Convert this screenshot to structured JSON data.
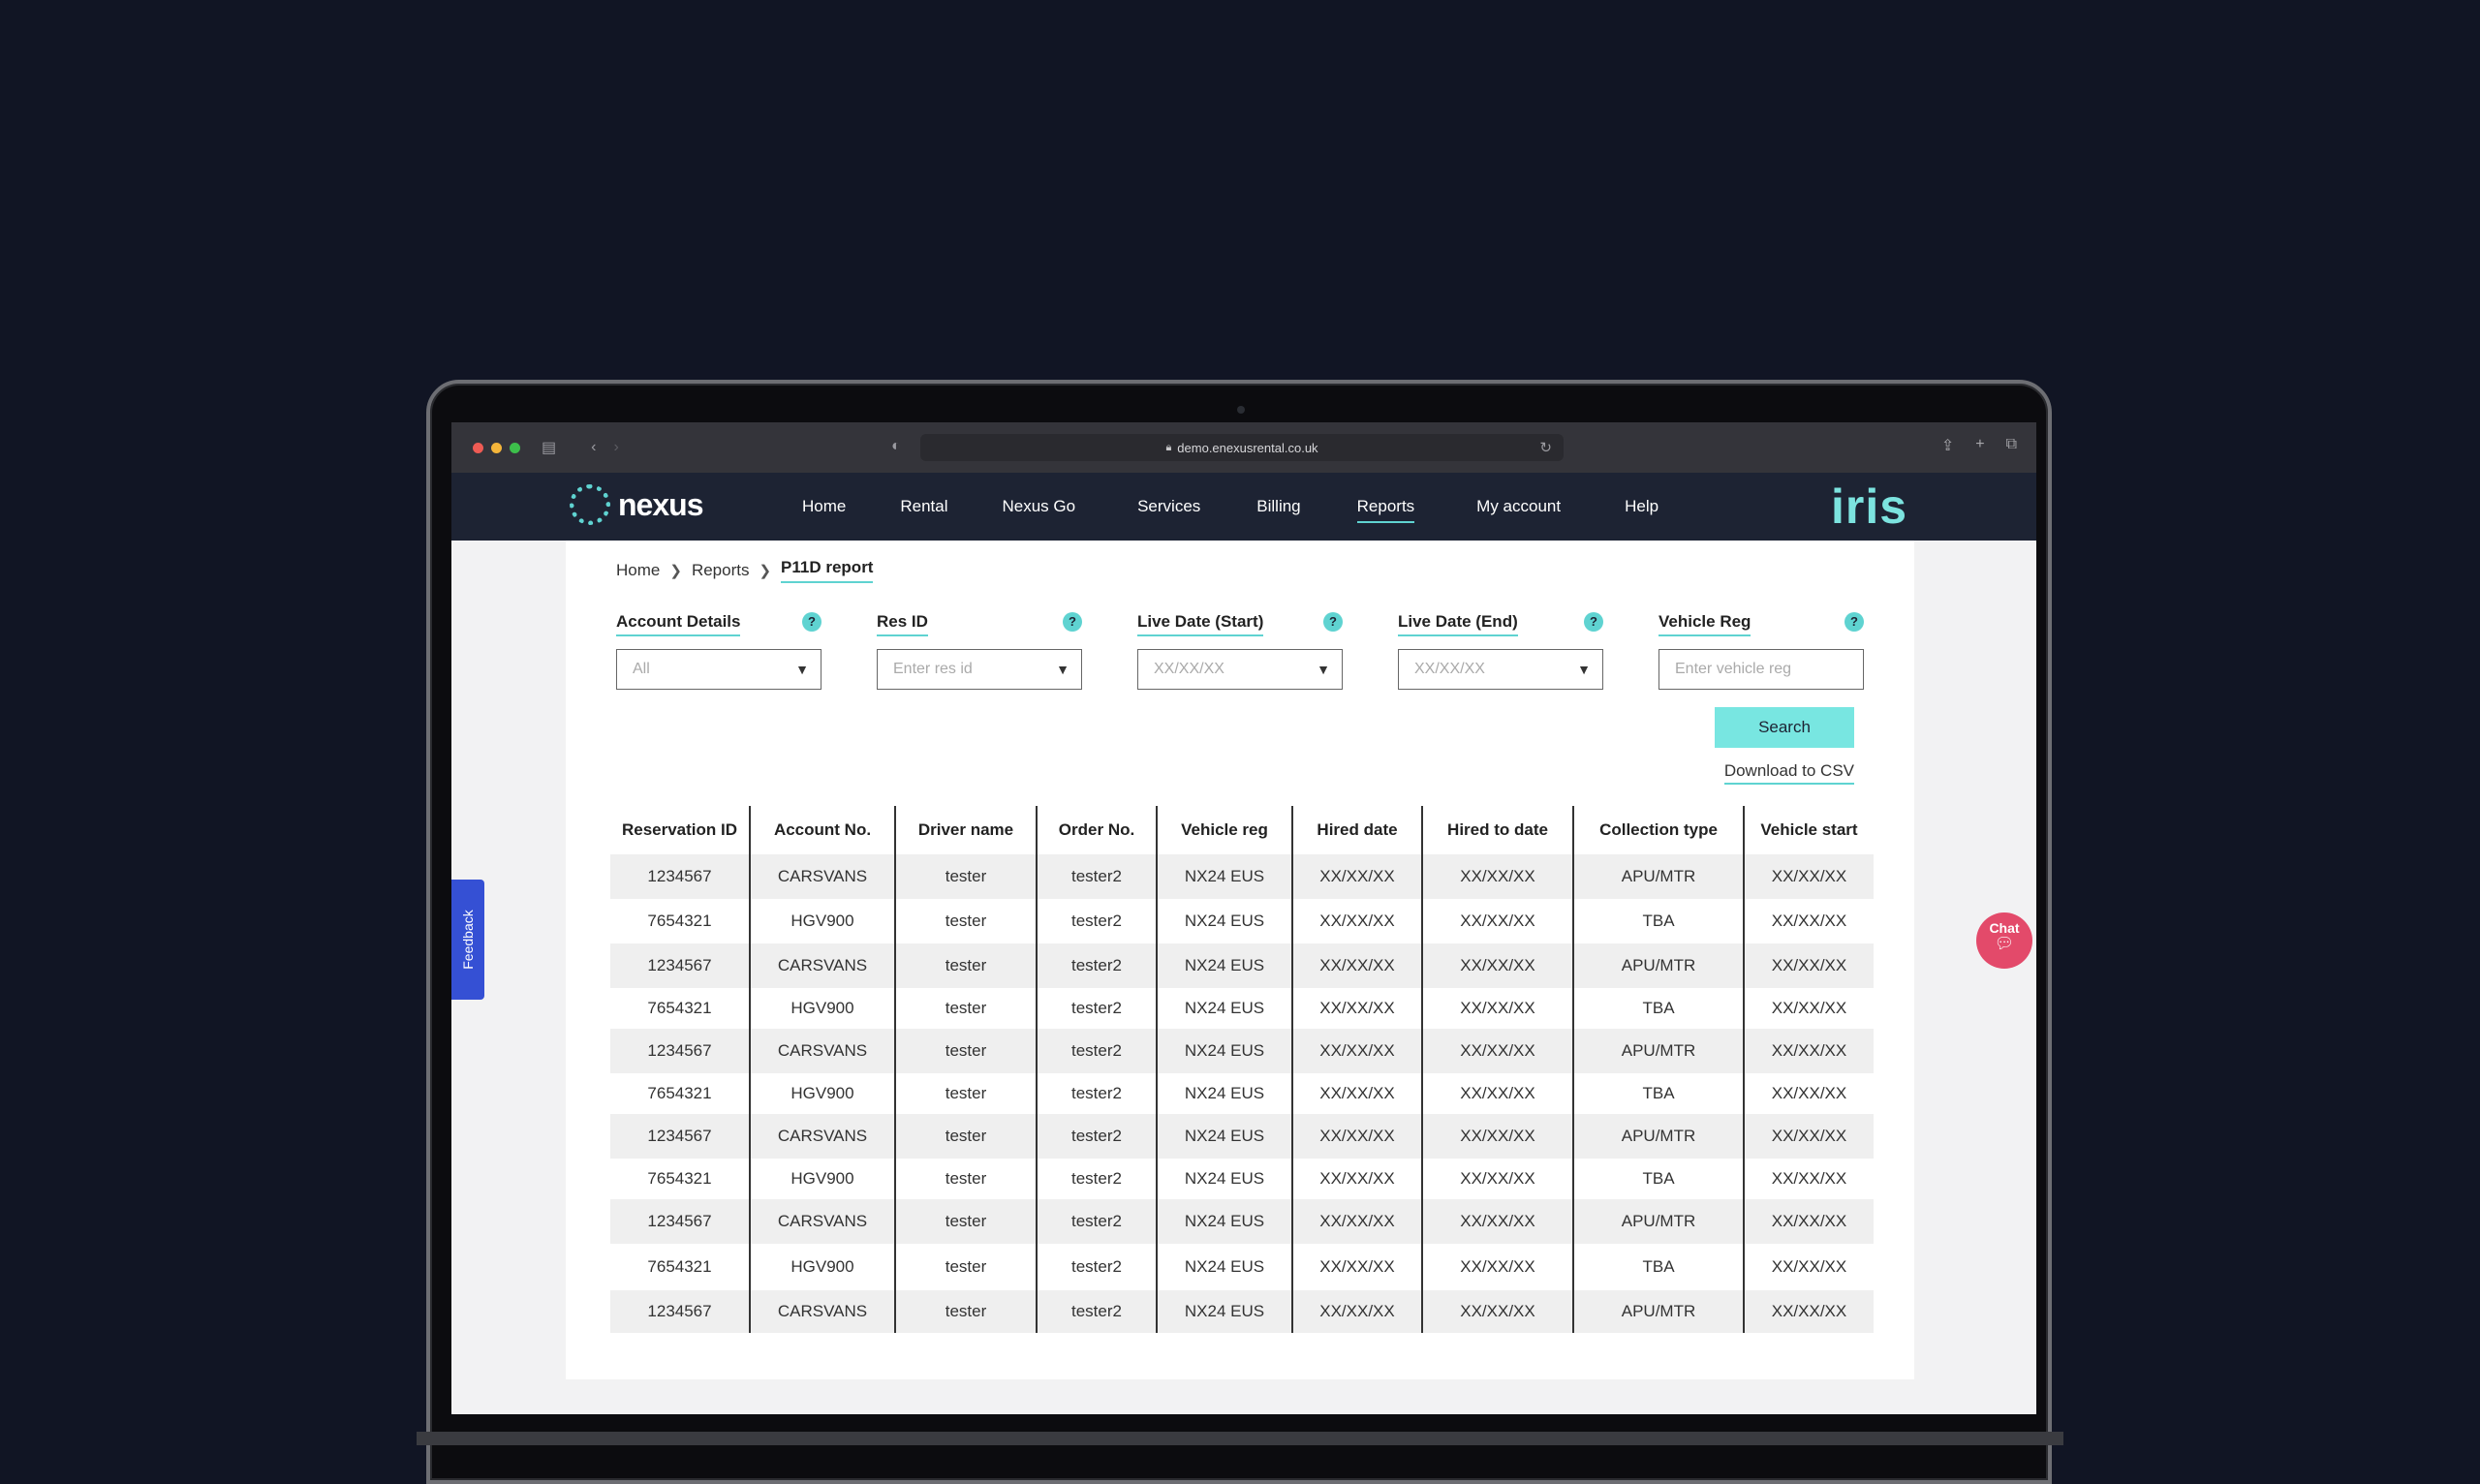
{
  "browser": {
    "url": "demo.enexusrental.co.uk"
  },
  "brand": {
    "logo_text": "nexus",
    "partner_logo": "iris"
  },
  "nav": {
    "items": [
      {
        "label": "Home"
      },
      {
        "label": "Rental"
      },
      {
        "label": "Nexus Go"
      },
      {
        "label": "Services"
      },
      {
        "label": "Billing"
      },
      {
        "label": "Reports",
        "active": true
      },
      {
        "label": "My account"
      },
      {
        "label": "Help"
      }
    ]
  },
  "breadcrumb": {
    "home": "Home",
    "reports": "Reports",
    "current": "P11D report"
  },
  "filters": {
    "account": {
      "label": "Account Details",
      "value": "All"
    },
    "res_id": {
      "label": "Res ID",
      "placeholder": "Enter res id"
    },
    "live_start": {
      "label": "Live Date (Start)",
      "placeholder": "XX/XX/XX"
    },
    "live_end": {
      "label": "Live Date (End)",
      "placeholder": "XX/XX/XX"
    },
    "vehicle_reg": {
      "label": "Vehicle Reg",
      "placeholder": "Enter vehicle reg"
    },
    "help_glyph": "?"
  },
  "actions": {
    "search": "Search",
    "download": "Download to CSV"
  },
  "table": {
    "headers": [
      "Reservation ID",
      "Account No.",
      "Driver name",
      "Order No.",
      "Vehicle reg",
      "Hired date",
      "Hired to date",
      "Collection type",
      "Vehicle start"
    ],
    "rows": [
      [
        "1234567",
        "CARSVANS",
        "tester",
        "tester2",
        "NX24 EUS",
        "XX/XX/XX",
        "XX/XX/XX",
        "APU/MTR",
        "XX/XX/XX"
      ],
      [
        "7654321",
        "HGV900",
        "tester",
        "tester2",
        "NX24 EUS",
        "XX/XX/XX",
        "XX/XX/XX",
        "TBA",
        "XX/XX/XX"
      ],
      [
        "1234567",
        "CARSVANS",
        "tester",
        "tester2",
        "NX24 EUS",
        "XX/XX/XX",
        "XX/XX/XX",
        "APU/MTR",
        "XX/XX/XX"
      ],
      [
        "7654321",
        "HGV900",
        "tester",
        "tester2",
        "NX24 EUS",
        "XX/XX/XX",
        "XX/XX/XX",
        "TBA",
        "XX/XX/XX"
      ],
      [
        "1234567",
        "CARSVANS",
        "tester",
        "tester2",
        "NX24 EUS",
        "XX/XX/XX",
        "XX/XX/XX",
        "APU/MTR",
        "XX/XX/XX"
      ],
      [
        "7654321",
        "HGV900",
        "tester",
        "tester2",
        "NX24 EUS",
        "XX/XX/XX",
        "XX/XX/XX",
        "TBA",
        "XX/XX/XX"
      ],
      [
        "1234567",
        "CARSVANS",
        "tester",
        "tester2",
        "NX24 EUS",
        "XX/XX/XX",
        "XX/XX/XX",
        "APU/MTR",
        "XX/XX/XX"
      ],
      [
        "7654321",
        "HGV900",
        "tester",
        "tester2",
        "NX24 EUS",
        "XX/XX/XX",
        "XX/XX/XX",
        "TBA",
        "XX/XX/XX"
      ],
      [
        "1234567",
        "CARSVANS",
        "tester",
        "tester2",
        "NX24 EUS",
        "XX/XX/XX",
        "XX/XX/XX",
        "APU/MTR",
        "XX/XX/XX"
      ],
      [
        "7654321",
        "HGV900",
        "tester",
        "tester2",
        "NX24 EUS",
        "XX/XX/XX",
        "XX/XX/XX",
        "TBA",
        "XX/XX/XX"
      ],
      [
        "1234567",
        "CARSVANS",
        "tester",
        "tester2",
        "NX24 EUS",
        "XX/XX/XX",
        "XX/XX/XX",
        "APU/MTR",
        "XX/XX/XX"
      ]
    ]
  },
  "widgets": {
    "feedback": "Feedback",
    "chat": "Chat"
  },
  "colors": {
    "accent": "#5fd3d1",
    "search_button": "#78e6e1",
    "nav_bg": "#1d2333",
    "page_bg": "#111524",
    "feedback_tab": "#3550d4",
    "chat_bubble": "#e34a6a"
  },
  "icons": {
    "breadcrumb_separator": "chevron-right-icon",
    "select_arrow": "chevron-down-icon",
    "help": "help-icon",
    "chat": "chat-icon",
    "lock": "lock-icon"
  }
}
